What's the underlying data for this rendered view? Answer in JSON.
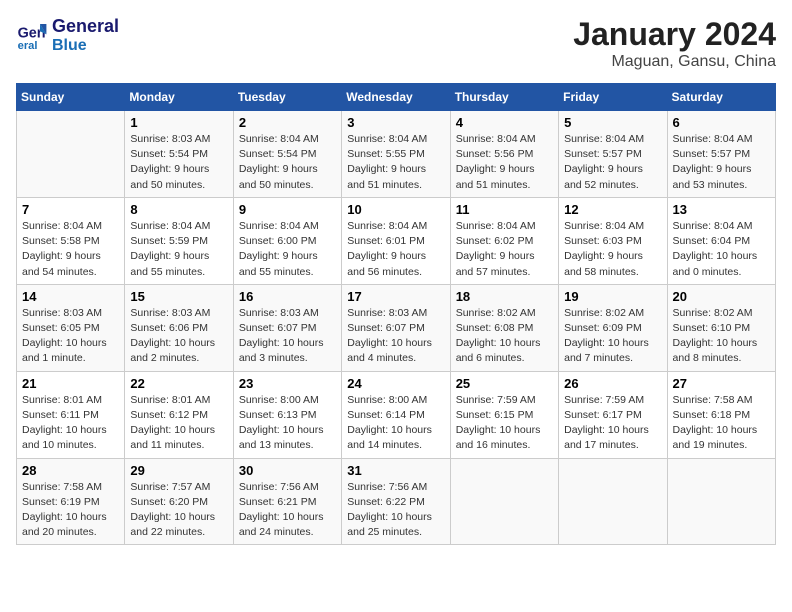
{
  "header": {
    "logo_line1": "General",
    "logo_line2": "Blue",
    "title": "January 2024",
    "subtitle": "Maguan, Gansu, China"
  },
  "columns": [
    "Sunday",
    "Monday",
    "Tuesday",
    "Wednesday",
    "Thursday",
    "Friday",
    "Saturday"
  ],
  "weeks": [
    {
      "days": [
        {
          "num": "",
          "info": ""
        },
        {
          "num": "1",
          "info": "Sunrise: 8:03 AM\nSunset: 5:54 PM\nDaylight: 9 hours\nand 50 minutes."
        },
        {
          "num": "2",
          "info": "Sunrise: 8:04 AM\nSunset: 5:54 PM\nDaylight: 9 hours\nand 50 minutes."
        },
        {
          "num": "3",
          "info": "Sunrise: 8:04 AM\nSunset: 5:55 PM\nDaylight: 9 hours\nand 51 minutes."
        },
        {
          "num": "4",
          "info": "Sunrise: 8:04 AM\nSunset: 5:56 PM\nDaylight: 9 hours\nand 51 minutes."
        },
        {
          "num": "5",
          "info": "Sunrise: 8:04 AM\nSunset: 5:57 PM\nDaylight: 9 hours\nand 52 minutes."
        },
        {
          "num": "6",
          "info": "Sunrise: 8:04 AM\nSunset: 5:57 PM\nDaylight: 9 hours\nand 53 minutes."
        }
      ]
    },
    {
      "days": [
        {
          "num": "7",
          "info": "Sunrise: 8:04 AM\nSunset: 5:58 PM\nDaylight: 9 hours\nand 54 minutes."
        },
        {
          "num": "8",
          "info": "Sunrise: 8:04 AM\nSunset: 5:59 PM\nDaylight: 9 hours\nand 55 minutes."
        },
        {
          "num": "9",
          "info": "Sunrise: 8:04 AM\nSunset: 6:00 PM\nDaylight: 9 hours\nand 55 minutes."
        },
        {
          "num": "10",
          "info": "Sunrise: 8:04 AM\nSunset: 6:01 PM\nDaylight: 9 hours\nand 56 minutes."
        },
        {
          "num": "11",
          "info": "Sunrise: 8:04 AM\nSunset: 6:02 PM\nDaylight: 9 hours\nand 57 minutes."
        },
        {
          "num": "12",
          "info": "Sunrise: 8:04 AM\nSunset: 6:03 PM\nDaylight: 9 hours\nand 58 minutes."
        },
        {
          "num": "13",
          "info": "Sunrise: 8:04 AM\nSunset: 6:04 PM\nDaylight: 10 hours\nand 0 minutes."
        }
      ]
    },
    {
      "days": [
        {
          "num": "14",
          "info": "Sunrise: 8:03 AM\nSunset: 6:05 PM\nDaylight: 10 hours\nand 1 minute."
        },
        {
          "num": "15",
          "info": "Sunrise: 8:03 AM\nSunset: 6:06 PM\nDaylight: 10 hours\nand 2 minutes."
        },
        {
          "num": "16",
          "info": "Sunrise: 8:03 AM\nSunset: 6:07 PM\nDaylight: 10 hours\nand 3 minutes."
        },
        {
          "num": "17",
          "info": "Sunrise: 8:03 AM\nSunset: 6:07 PM\nDaylight: 10 hours\nand 4 minutes."
        },
        {
          "num": "18",
          "info": "Sunrise: 8:02 AM\nSunset: 6:08 PM\nDaylight: 10 hours\nand 6 minutes."
        },
        {
          "num": "19",
          "info": "Sunrise: 8:02 AM\nSunset: 6:09 PM\nDaylight: 10 hours\nand 7 minutes."
        },
        {
          "num": "20",
          "info": "Sunrise: 8:02 AM\nSunset: 6:10 PM\nDaylight: 10 hours\nand 8 minutes."
        }
      ]
    },
    {
      "days": [
        {
          "num": "21",
          "info": "Sunrise: 8:01 AM\nSunset: 6:11 PM\nDaylight: 10 hours\nand 10 minutes."
        },
        {
          "num": "22",
          "info": "Sunrise: 8:01 AM\nSunset: 6:12 PM\nDaylight: 10 hours\nand 11 minutes."
        },
        {
          "num": "23",
          "info": "Sunrise: 8:00 AM\nSunset: 6:13 PM\nDaylight: 10 hours\nand 13 minutes."
        },
        {
          "num": "24",
          "info": "Sunrise: 8:00 AM\nSunset: 6:14 PM\nDaylight: 10 hours\nand 14 minutes."
        },
        {
          "num": "25",
          "info": "Sunrise: 7:59 AM\nSunset: 6:15 PM\nDaylight: 10 hours\nand 16 minutes."
        },
        {
          "num": "26",
          "info": "Sunrise: 7:59 AM\nSunset: 6:17 PM\nDaylight: 10 hours\nand 17 minutes."
        },
        {
          "num": "27",
          "info": "Sunrise: 7:58 AM\nSunset: 6:18 PM\nDaylight: 10 hours\nand 19 minutes."
        }
      ]
    },
    {
      "days": [
        {
          "num": "28",
          "info": "Sunrise: 7:58 AM\nSunset: 6:19 PM\nDaylight: 10 hours\nand 20 minutes."
        },
        {
          "num": "29",
          "info": "Sunrise: 7:57 AM\nSunset: 6:20 PM\nDaylight: 10 hours\nand 22 minutes."
        },
        {
          "num": "30",
          "info": "Sunrise: 7:56 AM\nSunset: 6:21 PM\nDaylight: 10 hours\nand 24 minutes."
        },
        {
          "num": "31",
          "info": "Sunrise: 7:56 AM\nSunset: 6:22 PM\nDaylight: 10 hours\nand 25 minutes."
        },
        {
          "num": "",
          "info": ""
        },
        {
          "num": "",
          "info": ""
        },
        {
          "num": "",
          "info": ""
        }
      ]
    }
  ]
}
